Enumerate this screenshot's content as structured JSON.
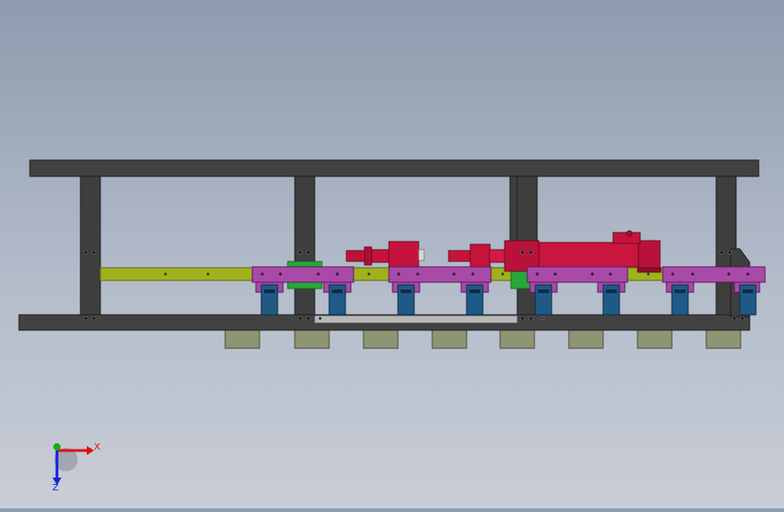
{
  "viewport": {
    "background_top": "#8e9bae",
    "background_bottom": "#c9cdd6"
  },
  "colors": {
    "frame": "#424242",
    "frame_dark": "#2a2a2a",
    "rail": "#9fb21e",
    "carriage": "#a84aa8",
    "cylinder": "#c4143c",
    "cylinder_dark": "#8a0e2a",
    "bracket": "#1f5a86",
    "foot": "#8e9572",
    "green_clamp": "#27a838",
    "axis_x": "#e01010",
    "axis_y": "#10b010",
    "axis_z": "#1020e0"
  },
  "triad": {
    "x_label": "X",
    "z_label": "Z"
  }
}
